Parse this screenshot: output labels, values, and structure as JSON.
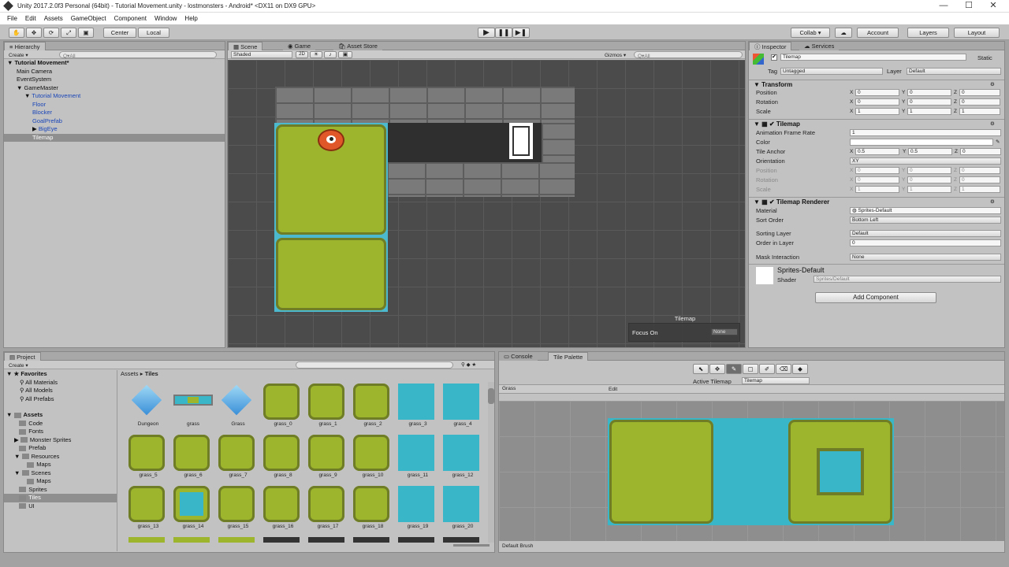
{
  "title_bar": {
    "title": "Unity 2017.2.0f3 Personal (64bit) - Tutorial Movement.unity - lostmonsters - Android* <DX11 on DX9 GPU>",
    "min": "—",
    "max": "☐",
    "close": "✕"
  },
  "menu": [
    "File",
    "Edit",
    "Assets",
    "GameObject",
    "Component",
    "Window",
    "Help"
  ],
  "toolbar": {
    "center": "Center",
    "local": "Local",
    "collab": "Collab ▾",
    "account": "Account",
    "layers": "Layers",
    "layout": "Layout"
  },
  "hierarchy": {
    "tab": "Hierarchy",
    "create": "Create ▾",
    "search_placeholder": "Q▾All",
    "scene": "Tutorial Movement*",
    "items": [
      {
        "label": "Main Camera",
        "indent": 1,
        "blue": false,
        "arrow": ""
      },
      {
        "label": "EventSystem",
        "indent": 1,
        "blue": false,
        "arrow": ""
      },
      {
        "label": "GameMaster",
        "indent": 1,
        "blue": false,
        "arrow": "▼"
      },
      {
        "label": "Tutorial Movement",
        "indent": 2,
        "blue": true,
        "arrow": "▼"
      },
      {
        "label": "Floor",
        "indent": 3,
        "blue": true,
        "arrow": ""
      },
      {
        "label": "Blocker",
        "indent": 3,
        "blue": true,
        "arrow": ""
      },
      {
        "label": "GoalPrefab",
        "indent": 3,
        "blue": true,
        "arrow": ""
      },
      {
        "label": "BigEye",
        "indent": 3,
        "blue": true,
        "arrow": "▶"
      },
      {
        "label": "Tilemap",
        "indent": 3,
        "blue": false,
        "arrow": "",
        "selected": true
      }
    ]
  },
  "scene_view": {
    "tabs": [
      "Scene",
      "Game",
      "Asset Store"
    ],
    "shading": "Shaded",
    "mode_2d": "2D",
    "gizmos": "Gizmos ▾",
    "search_placeholder": "Q▾All",
    "overlay_title": "Tilemap",
    "focus_label": "Focus On",
    "focus_value": "None"
  },
  "inspector": {
    "tabs": [
      "Inspector",
      "Services"
    ],
    "object_name": "Tilemap",
    "static": "Static",
    "tag_label": "Tag",
    "tag_value": "Untagged",
    "layer_label": "Layer",
    "layer_value": "Default",
    "transform": {
      "title": "Transform",
      "rows": [
        {
          "label": "Position",
          "x": "0",
          "y": "0",
          "z": "0"
        },
        {
          "label": "Rotation",
          "x": "0",
          "y": "0",
          "z": "0"
        },
        {
          "label": "Scale",
          "x": "1",
          "y": "1",
          "z": "1"
        }
      ]
    },
    "tilemap": {
      "title": "Tilemap",
      "frame_rate_label": "Animation Frame Rate",
      "frame_rate": "1",
      "color_label": "Color",
      "anchor_label": "Tile Anchor",
      "anchor": {
        "x": "0.5",
        "y": "0.5",
        "z": "0"
      },
      "orientation_label": "Orientation",
      "orientation": "XY",
      "disabled": [
        {
          "label": "Position",
          "x": "0",
          "y": "0",
          "z": "0"
        },
        {
          "label": "Rotation",
          "x": "0",
          "y": "0",
          "z": "0"
        },
        {
          "label": "Scale",
          "x": "1",
          "y": "1",
          "z": "1"
        }
      ]
    },
    "renderer": {
      "title": "Tilemap Renderer",
      "material_label": "Material",
      "material": "Sprites-Default",
      "sort_label": "Sort Order",
      "sort": "Bottom Left",
      "sorting_layer_label": "Sorting Layer",
      "sorting_layer": "Default",
      "order_label": "Order in Layer",
      "order": "0",
      "mask_label": "Mask Interaction",
      "mask": "None"
    },
    "material_name": "Sprites-Default",
    "shader_label": "Shader",
    "shader": "Sprites/Default",
    "add_component": "Add Component"
  },
  "project": {
    "tab": "Project",
    "create": "Create ▾",
    "breadcrumb_root": "Assets",
    "breadcrumb_leaf": "Tiles",
    "favorites": [
      "Favorites",
      "All Materials",
      "All Models",
      "All Prefabs"
    ],
    "tree": [
      {
        "label": "Assets",
        "indent": 0,
        "arrow": "▼",
        "bold": true
      },
      {
        "label": "Code",
        "indent": 1,
        "arrow": ""
      },
      {
        "label": "Fonts",
        "indent": 1,
        "arrow": ""
      },
      {
        "label": "Monster Sprites",
        "indent": 1,
        "arrow": "▶"
      },
      {
        "label": "Prefab",
        "indent": 1,
        "arrow": ""
      },
      {
        "label": "Resources",
        "indent": 1,
        "arrow": "▼"
      },
      {
        "label": "Maps",
        "indent": 2,
        "arrow": ""
      },
      {
        "label": "Scenes",
        "indent": 1,
        "arrow": "▼"
      },
      {
        "label": "Maps",
        "indent": 2,
        "arrow": ""
      },
      {
        "label": "Sprites",
        "indent": 1,
        "arrow": ""
      },
      {
        "label": "Tiles",
        "indent": 1,
        "arrow": "",
        "selected": true
      },
      {
        "label": "UI",
        "indent": 1,
        "arrow": ""
      }
    ],
    "assets": [
      {
        "label": "Dungeon",
        "kind": "cube"
      },
      {
        "label": "grass",
        "kind": "strip"
      },
      {
        "label": "Grass",
        "kind": "cube"
      },
      {
        "label": "grass_0",
        "kind": "grass"
      },
      {
        "label": "grass_1",
        "kind": "grass"
      },
      {
        "label": "grass_2",
        "kind": "grass"
      },
      {
        "label": "grass_3",
        "kind": "water"
      },
      {
        "label": "grass_4",
        "kind": "water"
      },
      {
        "label": "grass_5",
        "kind": "grass"
      },
      {
        "label": "grass_6",
        "kind": "grass"
      },
      {
        "label": "grass_7",
        "kind": "grass"
      },
      {
        "label": "grass_8",
        "kind": "grass"
      },
      {
        "label": "grass_9",
        "kind": "grass"
      },
      {
        "label": "grass_10",
        "kind": "grass"
      },
      {
        "label": "grass_11",
        "kind": "water"
      },
      {
        "label": "grass_12",
        "kind": "water"
      },
      {
        "label": "grass_13",
        "kind": "grass"
      },
      {
        "label": "grass_14",
        "kind": "waterhole"
      },
      {
        "label": "grass_15",
        "kind": "grass"
      },
      {
        "label": "grass_16",
        "kind": "grass"
      },
      {
        "label": "grass_17",
        "kind": "grass"
      },
      {
        "label": "grass_18",
        "kind": "grass"
      },
      {
        "label": "grass_19",
        "kind": "water"
      },
      {
        "label": "grass_20",
        "kind": "water"
      }
    ]
  },
  "palette": {
    "tabs": [
      "Console",
      "Tile Palette"
    ],
    "active_label": "Active Tilemap",
    "active_value": "Tilemap",
    "palette_name": "Grass",
    "edit": "Edit",
    "brush": "Default Brush"
  }
}
